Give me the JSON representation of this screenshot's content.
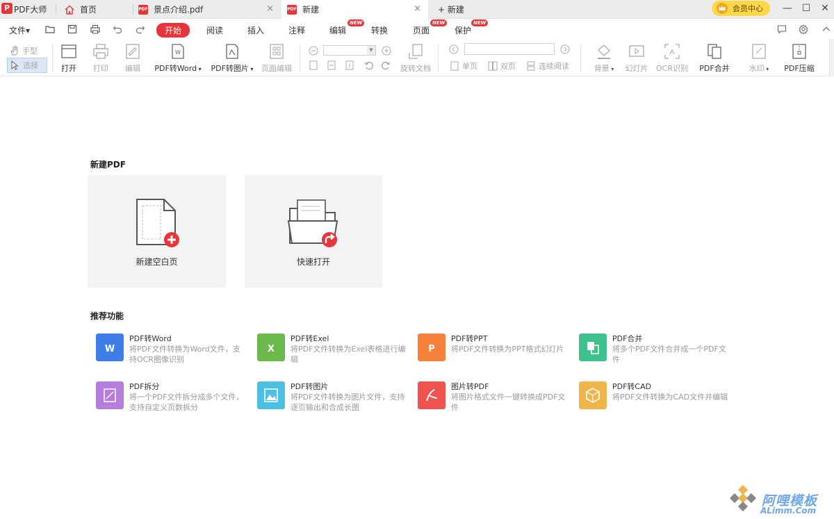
{
  "app": {
    "name": "PDF大师",
    "logo_letter": "P"
  },
  "tabs": [
    {
      "label": "首页",
      "icon": "home-icon"
    },
    {
      "label": "景点介绍.pdf",
      "icon": "pdf-file-icon",
      "close": "×"
    },
    {
      "label": "新建",
      "icon": "pdf-file-icon",
      "close": "×",
      "active": true
    }
  ],
  "new_tab": {
    "label": "+ 新建"
  },
  "vip": {
    "label": "会员中心"
  },
  "window": {
    "minimize": "—",
    "maximize": "☐",
    "close": "✕"
  },
  "menu": {
    "file": "文件▾",
    "items": [
      "开始",
      "阅读",
      "插入",
      "注释",
      "编辑",
      "转换",
      "页面",
      "保护"
    ],
    "new_badge": "NEW"
  },
  "ribbon": {
    "hand": "手型",
    "select": "选择",
    "open": "打开",
    "print": "打印",
    "edit": "编辑",
    "pdf_to_word": "PDF转Word",
    "pdf_to_image": "PDF转图片",
    "page_edit": "页面编辑",
    "rotate_doc": "旋转文档",
    "single_page": "单页",
    "double_page": "双页",
    "continuous": "连续阅读",
    "background": "背景",
    "slideshow": "幻灯片",
    "ocr": "OCR识别",
    "pdf_merge": "PDF合并",
    "watermark": "水印",
    "pdf_compress": "PDF压缩"
  },
  "main": {
    "new_pdf_title": "新建PDF",
    "blank_page": "新建空白页",
    "quick_open": "快速打开",
    "features_title": "推荐功能",
    "features": [
      {
        "title": "PDF转Word",
        "desc": "将PDF文件转换为Word文件，支持OCR图像识别",
        "color": "#3d7fe6",
        "icon": "word-icon"
      },
      {
        "title": "PDF转Exel",
        "desc": "将PDF文件转换为Exel表格进行编辑",
        "color": "#6ab94a",
        "icon": "excel-icon"
      },
      {
        "title": "PDF转PPT",
        "desc": "将PDF文件转换为PPT格式幻灯片",
        "color": "#f5823a",
        "icon": "ppt-icon"
      },
      {
        "title": "PDF合并",
        "desc": "将多个PDF文件合并成一个PDF文件",
        "color": "#3fc18e",
        "icon": "merge-icon"
      },
      {
        "title": "PDF拆分",
        "desc": "将一个PDF文件拆分成多个文件，支持自定义页数拆分",
        "color": "#b57de0",
        "icon": "split-icon"
      },
      {
        "title": "PDF转图片",
        "desc": "将PDF文件转换为图片文件，支持逐页输出和合成长图",
        "color": "#4dbfe0",
        "icon": "image-icon"
      },
      {
        "title": "图片转PDF",
        "desc": "将图片格式文件一键转换成PDF文件",
        "color": "#ee5350",
        "icon": "image-to-pdf-icon"
      },
      {
        "title": "PDF转CAD",
        "desc": "将PDF文件转换为CAD文件并编辑",
        "color": "#f0b54a",
        "icon": "cad-icon"
      }
    ]
  },
  "watermark": {
    "line1": "阿哩模板",
    "line2": "ALimm.Com"
  }
}
